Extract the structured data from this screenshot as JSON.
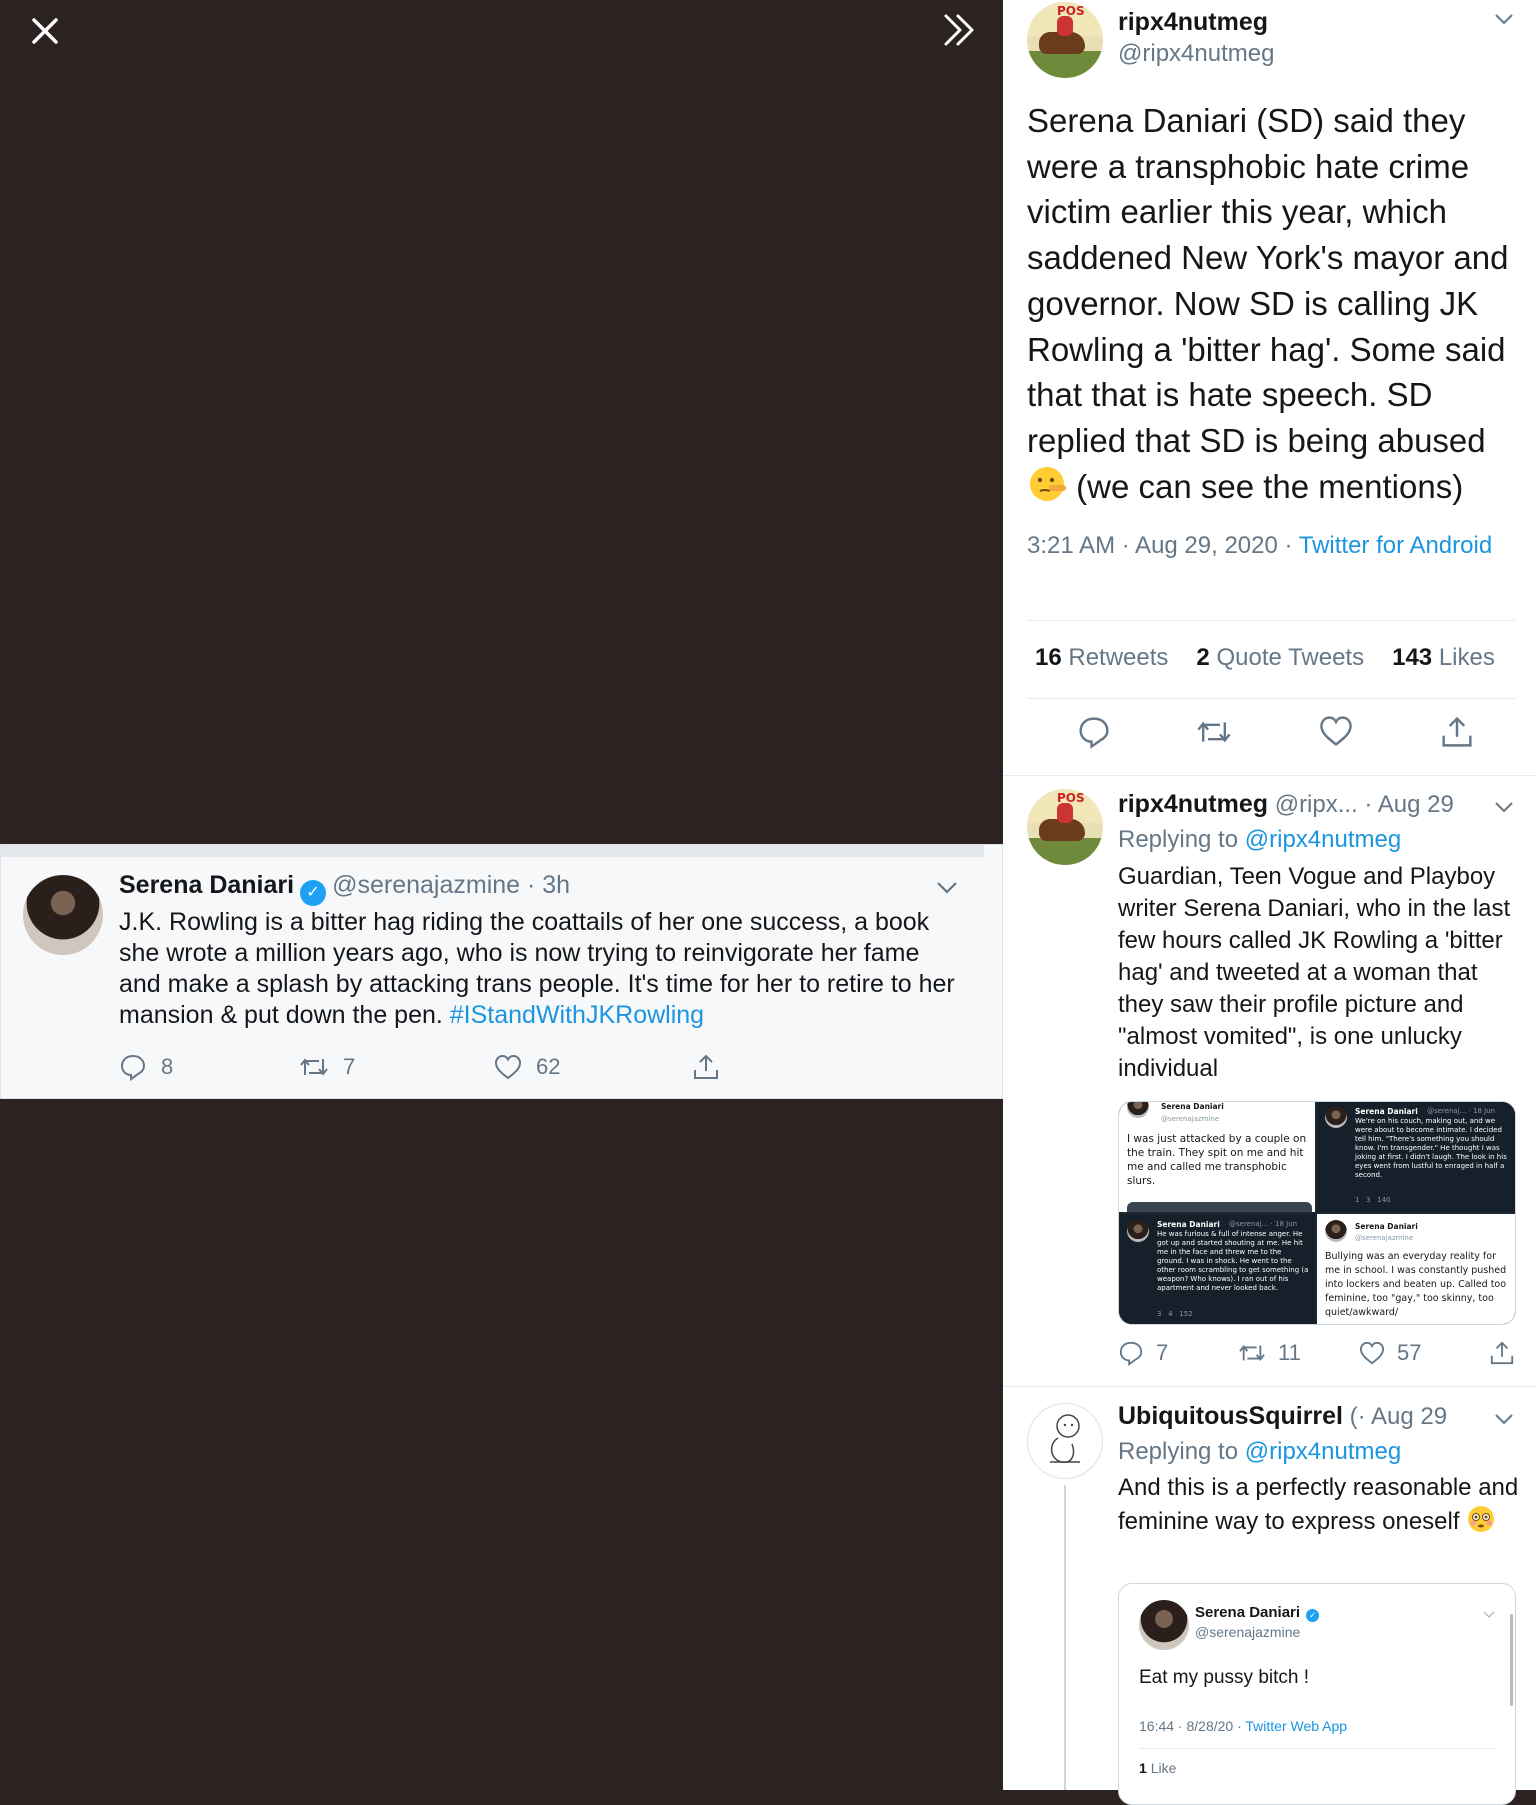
{
  "viewer": {
    "close_icon": "close-icon",
    "expand_icon": "double-chevron-right-icon"
  },
  "embedded_tweet": {
    "name": "Serena Daniari",
    "handle": "@serenajazmine",
    "time": " · 3h",
    "text": "J.K. Rowling is a bitter hag riding the coattails of her one success, a book she wrote a million years ago, who is now trying to reinvigorate her fame and make a splash by attacking trans people. It's time for her to retire to her mansion & put down the pen.",
    "hashtag": "#IStandWithJKRowling",
    "replies": "8",
    "retweets": "7",
    "likes": "62"
  },
  "main_tweet": {
    "name": "ripx4nutmeg",
    "handle": "@ripx4nutmeg",
    "text": "Serena Daniari (SD) said they were a transphobic hate crime victim earlier this year, which saddened New York's mayor and governor. Now SD is calling JK Rowling a 'bitter hag'. Some said that that is hate speech. SD replied that SD is being abused",
    "text_end": " (we can see the mentions)",
    "timestamp": "3:21 AM · Aug 29, 2020 · ",
    "source": "Twitter for Android",
    "retweets_count": "16",
    "retweets_label": "Retweets",
    "quotes_count": "2",
    "quotes_label": "Quote Tweets",
    "likes_count": "143",
    "likes_label": "Likes"
  },
  "reply1": {
    "name": "ripx4nutmeg",
    "handle_date": "@ripx... · Aug 29",
    "replying_label": "Replying to ",
    "replying_handle": "@ripx4nutmeg",
    "text": "Guardian, Teen Vogue and Playboy writer Serena Daniari, who in the last few hours called JK Rowling a 'bitter hag' and tweeted at a woman that they saw their profile picture and \"almost vomited\", is one unlucky individual",
    "replies": "7",
    "retweets": "11",
    "likes": "57",
    "images": {
      "img1_name": "Serena Daniari",
      "img1_handle": "@serenajazmine",
      "img1_text": "I was just attacked by a couple on the train. They spit on me and hit me and called me transphobic slurs.",
      "img2_name": "Serena Daniari",
      "img2_handle": "@serenaj... · 18 Jun",
      "img2_text": "We're on his couch, making out, and we were about to become intimate. I decided tell him. \"There's something you should know. I'm transgender.\" He thought I was joking at first. I didn't laugh. The look in his eyes went from lustful to enraged in half a second.",
      "img2_counts": "1   3   140",
      "img3_name": "Serena Daniari",
      "img3_handle": "@serenaj... · 18 Jun",
      "img3_text": "He was furious & full of intense anger. He got up and started shouting at me. He hit me in the face and threw me to the ground. I was in shock. He went to the other room scrambling to get something (a weapon? Who knows). I ran out of his apartment and never looked back.",
      "img3_counts": "3   4   152",
      "img4_name": "Serena Daniari",
      "img4_handle": "@serenajazmine",
      "img4_text": "Bullying was an everyday reality for me in school. I was constantly pushed into lockers and beaten up. Called too feminine, too \"gay,\" too skinny, too quiet/awkward/"
    }
  },
  "reply2": {
    "name": "UbiquitousSquirrel",
    "handle_date": "(· Aug 29",
    "replying_label": "Replying to ",
    "replying_handle": "@ripx4nutmeg",
    "text": "And this is a perfectly reasonable and feminine way to express oneself",
    "quote": {
      "name": "Serena Daniari",
      "handle": "@serenajazmine",
      "text": "Eat my pussy bitch !",
      "meta": "16:44 · 8/28/20 · ",
      "source": "Twitter Web App",
      "likes_count": "1",
      "likes_label": "Like"
    }
  },
  "colors": {
    "viewer_bg": "#2b2221",
    "link": "#1b95e0",
    "secondary_text": "#657786",
    "verified": "#1da1f2"
  }
}
